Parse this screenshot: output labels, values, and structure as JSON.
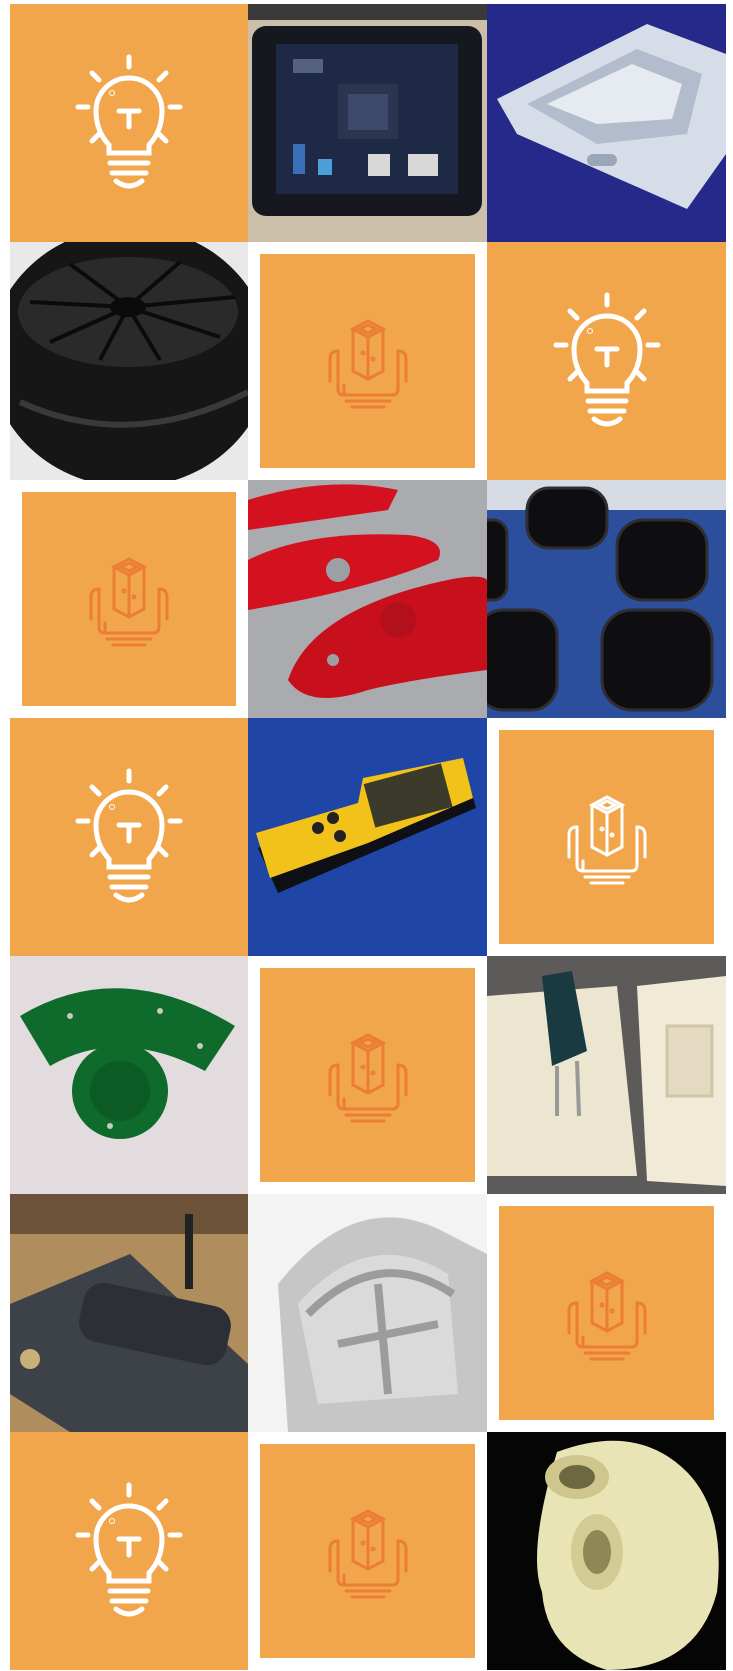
{
  "colors": {
    "orange": "#f2a64b",
    "icon_white": "#ffffff",
    "icon_faint": "#eb7d35",
    "background": "#ffffff"
  },
  "tiles": [
    {
      "kind": "bulb-icon"
    },
    {
      "kind": "photo",
      "subject": "circuit-board-enclosure"
    },
    {
      "kind": "photo",
      "subject": "white-plastic-housing"
    },
    {
      "kind": "photo",
      "subject": "black-wheel"
    },
    {
      "kind": "prototype-icon",
      "framed": true
    },
    {
      "kind": "bulb-icon"
    },
    {
      "kind": "prototype-icon",
      "framed": true
    },
    {
      "kind": "photo",
      "subject": "red-cut-parts"
    },
    {
      "kind": "photo",
      "subject": "black-rubber-bellows"
    },
    {
      "kind": "bulb-icon"
    },
    {
      "kind": "photo",
      "subject": "yellow-handheld-device"
    },
    {
      "kind": "prototype-icon",
      "framed": true,
      "bright": true
    },
    {
      "kind": "photo",
      "subject": "green-pcb-arc"
    },
    {
      "kind": "prototype-icon",
      "framed": true
    },
    {
      "kind": "photo",
      "subject": "silicone-mold"
    },
    {
      "kind": "photo",
      "subject": "cnc-machining"
    },
    {
      "kind": "photo",
      "subject": "grey-molded-part"
    },
    {
      "kind": "prototype-icon",
      "framed": true
    },
    {
      "kind": "bulb-icon"
    },
    {
      "kind": "prototype-icon",
      "framed": true
    },
    {
      "kind": "photo",
      "subject": "translucent-printed-part"
    }
  ]
}
